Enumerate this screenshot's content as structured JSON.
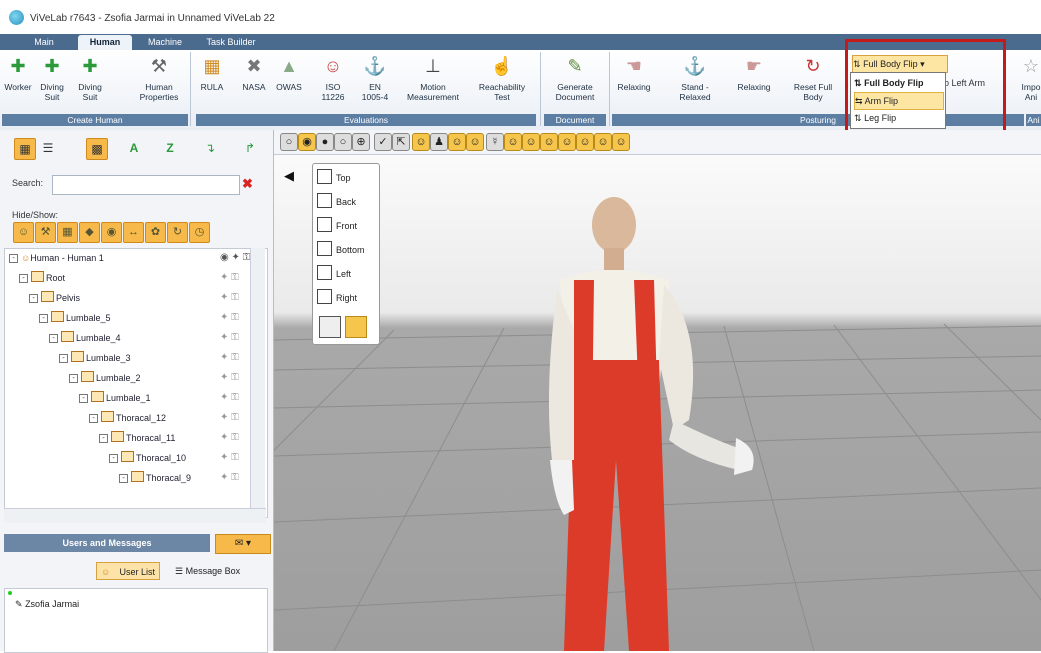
{
  "window": {
    "title": "ViVeLab r7643 - Zsofia Jarmai in Unnamed ViVeLab 22"
  },
  "tabs": [
    "Main",
    "Human",
    "Machine",
    "Task Builder"
  ],
  "ribbon": {
    "groups": [
      {
        "name": "Create Human",
        "buttons": [
          "Worker",
          "Diving Suit",
          "Diving Suit",
          "Human Properties"
        ]
      },
      {
        "name": "Evaluations",
        "buttons": [
          "RULA",
          "NASA",
          "OWAS",
          "ISO 11226",
          "EN 1005-4",
          "Motion Measurement",
          "Reachability Test"
        ]
      },
      {
        "name": "Document",
        "buttons": [
          "Generate Document"
        ]
      },
      {
        "name": "Posturing",
        "buttons": [
          "Relaxing",
          "Stand - Relaxed",
          "Relaxing",
          "Reset Full Body"
        ]
      },
      {
        "name": "Ani",
        "buttons": [
          "Impo Ani"
        ]
      }
    ],
    "flip_menu": {
      "header": "Full Body Flip",
      "items": [
        "Full Body Flip",
        "Arm Flip",
        "Leg Flip"
      ],
      "partial_label": "o Left Arm"
    }
  },
  "panel": {
    "search_label": "Search:",
    "search_value": "",
    "hideshow_label": "Hide/Show:",
    "tree": [
      {
        "label": "Human - Human 1",
        "level": 0
      },
      {
        "label": "Root",
        "level": 1
      },
      {
        "label": "Pelvis",
        "level": 2
      },
      {
        "label": "Lumbale_5",
        "level": 3
      },
      {
        "label": "Lumbale_4",
        "level": 4
      },
      {
        "label": "Lumbale_3",
        "level": 5
      },
      {
        "label": "Lumbale_2",
        "level": 6
      },
      {
        "label": "Lumbale_1",
        "level": 7
      },
      {
        "label": "Thoracal_12",
        "level": 8
      },
      {
        "label": "Thoracal_11",
        "level": 9
      },
      {
        "label": "Thoracal_10",
        "level": 10
      },
      {
        "label": "Thoracal_9",
        "level": 11
      }
    ],
    "users_header": "Users and Messages",
    "user_list_label": "User List",
    "message_box_label": "Message Box",
    "user": "Zsofia Jarmai"
  },
  "views": [
    "Top",
    "Back",
    "Front",
    "Bottom",
    "Left",
    "Right"
  ],
  "colors": {
    "accent": "#f7b94a",
    "ribbon_group": "#5d7ea3",
    "highlight_box": "#c51a1a"
  }
}
